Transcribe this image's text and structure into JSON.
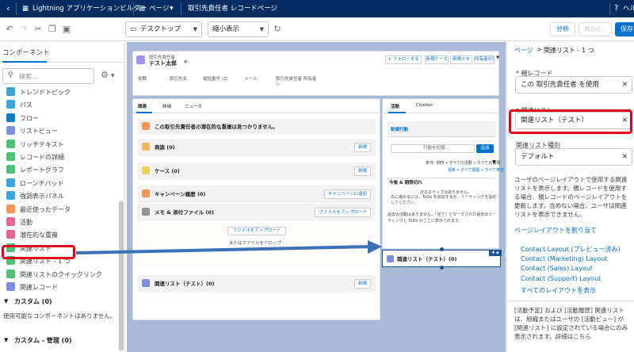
{
  "topbar": {
    "app_title": "Lightning アプリケーションビルダー",
    "page_label": "ページ",
    "record_page": "取引先責任者 レコードページ",
    "help": "ヘルプ"
  },
  "toolbar": {
    "device": "デスクトップ",
    "view": "縮小表示",
    "analyze": "分析",
    "activate": "有効化...",
    "save": "保存"
  },
  "left": {
    "heading": "コンポーネント",
    "search_placeholder": "検索...",
    "items": [
      {
        "label": "トレンドトピック",
        "color": "#3ba7d9"
      },
      {
        "label": "パス",
        "color": "#3ba7d9"
      },
      {
        "label": "フロー",
        "color": "#0c7fc2"
      },
      {
        "label": "リストビュー",
        "color": "#7f8de1"
      },
      {
        "label": "リッチテキスト",
        "color": "#4bc076"
      },
      {
        "label": "レコードの詳細",
        "color": "#4bc076"
      },
      {
        "label": "レポートグラフ",
        "color": "#4bc076"
      },
      {
        "label": "ローンチパッド",
        "color": "#3ba7d9"
      },
      {
        "label": "強調表示パネル",
        "color": "#3ba7d9"
      },
      {
        "label": "最近使ったデータ",
        "color": "#f49756"
      },
      {
        "label": "活動",
        "color": "#e56798"
      },
      {
        "label": "潜在的な重複",
        "color": "#e56798"
      },
      {
        "label": "関連リスト",
        "color": "#4bc076"
      },
      {
        "label": "関連リスト - 1 つ",
        "color": "#4bc076"
      },
      {
        "label": "関連リストのクイックリンク",
        "color": "#4bc076"
      },
      {
        "label": "関連レコード",
        "color": "#7f8de1"
      }
    ],
    "custom_heading": "カスタム (0)",
    "custom_empty": "使用可能なコンポーネントはありません。",
    "managed_heading": "カスタム - 管理 (0)"
  },
  "canvas": {
    "header": {
      "object": "取引先責任者",
      "name": "テスト太郎",
      "follow": "+ フォローする",
      "btn1": "新規ケース",
      "btn2": "新規メモ",
      "btn3": "所有者の変更",
      "fields": [
        "役職",
        "取引先名",
        "電話番号 (2)",
        "メール",
        "取引先責任者 所有者"
      ]
    },
    "tabs": [
      "関連",
      "詳細",
      "ニュース"
    ],
    "notice": "この取引先責任者の潜在的な重複は見つかりません。",
    "sections": [
      {
        "title": "商談 (0)",
        "button": "新規",
        "color": "#fcb95b"
      },
      {
        "title": "ケース (0)",
        "button": "新規",
        "color": "#f2cf5b"
      },
      {
        "title": "キャンペーン履歴 (0)",
        "button": "キャンペーンに追加",
        "color": "#f49756"
      },
      {
        "title": "メモ & 添付ファイル (0)",
        "button": "ファイルをアップロード",
        "color": "#969492"
      }
    ],
    "upload_button": "ファイルをアップロード",
    "drop_text": "またはファイルをドロップ",
    "related_list_main": "関連リスト（テスト）(0)",
    "related_list_main_button": "新規",
    "activity": {
      "tabs": [
        "活動",
        "Chatter"
      ],
      "new_task": "新規行動",
      "placeholder": "行動を記録...",
      "add": "追加",
      "filter": "条件: 常時 • すべての活動 • すべての種類",
      "refresh": "更新 • すべて展開 • すべて表示",
      "section": "今後 & 期限切れ",
      "empty1": "次のステップはありません。",
      "empty2": "先に進めるには、ToDo を追加するか、ミーティングを設定してください。",
      "past": "過去の活動はありません。「完了」とマークされた過去のミーティングと ToDo がここに表示されます。"
    },
    "related_list_drop": "関連リスト（テスト）(0)"
  },
  "right": {
    "breadcrumb_page": "ページ",
    "breadcrumb_sep": ">",
    "breadcrumb_current": "関連リスト - 1 つ",
    "parent_label": "* 親レコード",
    "parent_value": "この 取引先責任者 を使用",
    "related_label": "* 関連リスト",
    "related_value": "関連リスト（テスト）",
    "type_label": "関連リスト種別",
    "type_value": "デフォルト",
    "description": "ユーザのページレイアウトで使用する関連リストを表示します。親レコードを使用する場合、親レコードのページレイアウトを更新します。含めない場合、ユーザは関連リストを表示できません。",
    "assign_link": "ページレイアウトを割り当て",
    "layouts": [
      "Contact Layout (プレビュー済み)",
      "Contact (Marketing) Layout",
      "Contact (Sales) Layout",
      "Contact (Support) Layout"
    ],
    "all_layouts": "すべてのレイアウトを表示",
    "footer_note": "[活動予定] および [活動履歴] 関連リストは、組織またはユーザの [活動ビュー] が [関連リスト] に設定されている場合にのみ表示されます。詳細はこちら"
  },
  "colors": {
    "brand": "#032d60",
    "accent": "#0070d2",
    "highlight": "#e2001a",
    "arrow": "#3b6fb6"
  }
}
